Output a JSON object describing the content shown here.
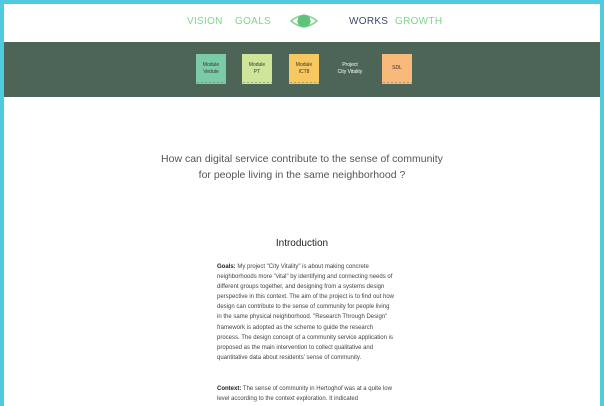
{
  "nav": {
    "vision": "VISION",
    "goals": "GOALS",
    "works": "WORKS",
    "growth": "GROWTH"
  },
  "colors": {
    "accent_green": "#7fd58b",
    "nav_dark": "#3b4a6b",
    "module_bar_bg": "#4d6557",
    "border": "#4ecbdf"
  },
  "modules": [
    {
      "line1": "Module",
      "line2": "Vedute",
      "color": "#7ccba8"
    },
    {
      "line1": "Module",
      "line2": "PT",
      "color": "#cfe69a"
    },
    {
      "line1": "Module",
      "line2": "ICT8",
      "color": "#f6c85f"
    },
    {
      "line1": "Project",
      "line2": "City Vitality",
      "color": "#4d6557"
    },
    {
      "line1": "SDL",
      "line2": "",
      "color": "#f8b97a"
    }
  ],
  "main": {
    "question_line1": "How can digital service contribute to the sense of community",
    "question_line2": "for people living in the same neighborhood ?",
    "intro_title": "Introduction",
    "goals_label": "Goals:",
    "goals_text": " My project \"City Vitality\" is about making concrete neighborhoods more \"vital\" by identifying and connecting needs of different groups together, and designing from a systems design perspective in this context. The aim of the project is to find out how design can contribute to the sense of community for people living in the same physical neighborhood. \"Research Through Design\" framework is adopted as the scheme to guide the research process. The design concept of a community service application is proposed as the main intervention to collect qualitative and quantitative data about residents' sense of community.",
    "context_label": "Context:",
    "context_text": " The sense of community in Hertoghof was at a quite low level according to the context exploration. It indicated"
  }
}
